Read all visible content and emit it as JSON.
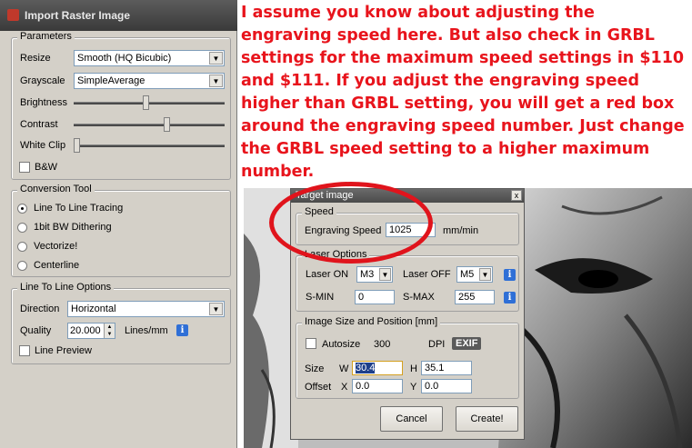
{
  "left_window": {
    "title": "Import Raster Image",
    "parameters": {
      "legend": "Parameters",
      "resize_label": "Resize",
      "resize_value": "Smooth (HQ Bicubic)",
      "grayscale_label": "Grayscale",
      "grayscale_value": "SimpleAverage",
      "brightness_label": "Brightness",
      "brightness_level": 0.48,
      "contrast_label": "Contrast",
      "contrast_level": 0.62,
      "whiteclip_label": "White Clip",
      "whiteclip_level": 0.0,
      "bw_label": "B&W"
    },
    "conversion": {
      "legend": "Conversion Tool",
      "options": [
        "Line To Line Tracing",
        "1bit BW Dithering",
        "Vectorize!",
        "Centerline"
      ],
      "selected": 0
    },
    "line_options": {
      "legend": "Line To Line Options",
      "direction_label": "Direction",
      "direction_value": "Horizontal",
      "quality_label": "Quality",
      "quality_value": "20.000",
      "quality_unit": "Lines/mm",
      "preview_label": "Line Preview"
    }
  },
  "annotation": "I assume you know about adjusting the engraving speed here. But also check in GRBL settings for the maximum speed settings in $110 and $111.  If you adjust the engraving speed higher than GRBL setting, you will get a red box around the engraving speed number. Just change the GRBL speed setting to a higher maximum number.",
  "dialog": {
    "title": "Target image",
    "close_glyph": "x",
    "speed": {
      "legend": "Speed",
      "label": "Engraving Speed",
      "value": "1025",
      "unit": "mm/min"
    },
    "laser": {
      "legend": "Laser Options",
      "on_label": "Laser ON",
      "on_value": "M3",
      "off_label": "Laser OFF",
      "off_value": "M5",
      "smin_label": "S-MIN",
      "smin_value": "0",
      "smax_label": "S-MAX",
      "smax_value": "255"
    },
    "size": {
      "legend": "Image Size and Position [mm]",
      "autosize_label": "Autosize",
      "dpi_value": "300",
      "dpi_label": "DPI",
      "exif_label": "EXIF",
      "size_label": "Size",
      "w_label": "W",
      "w_value": "30.4",
      "h_label": "H",
      "h_value": "35.1",
      "offset_label": "Offset",
      "x_label": "X",
      "x_value": "0.0",
      "y_label": "Y",
      "y_value": "0.0"
    },
    "cancel_label": "Cancel",
    "create_label": "Create!"
  },
  "colors": {
    "annotation": "#e8141c",
    "info_icon": "#2f6fd6",
    "window_bg": "#d4d0c8"
  },
  "icons": {
    "app": "app-icon",
    "info": "info-icon",
    "dropdown": "chevron-down-icon",
    "close": "close-icon"
  }
}
